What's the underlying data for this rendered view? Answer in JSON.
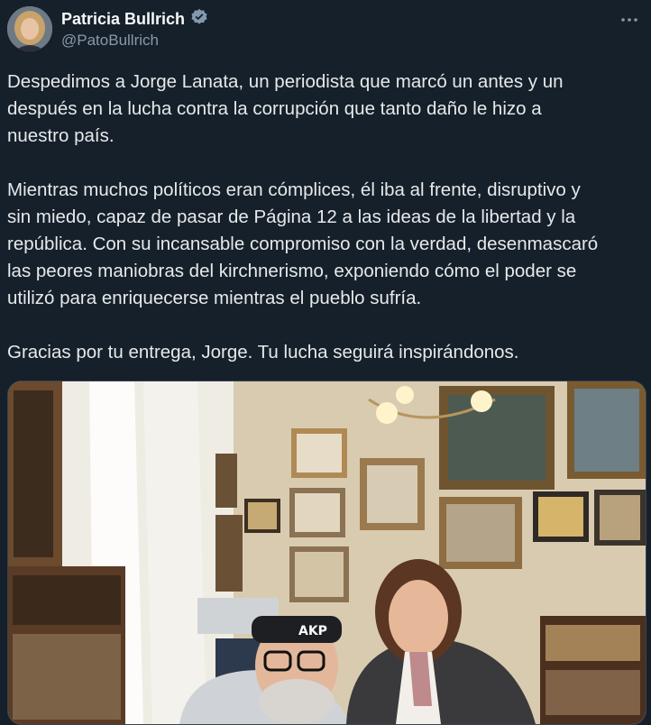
{
  "author": {
    "display_name": "Patricia Bullrich",
    "handle": "@PatoBullrich",
    "verified_icon": "verified-badge-icon",
    "avatar_icon": "avatar"
  },
  "tweet": {
    "text": "Despedimos a Jorge Lanata, un periodista que marcó un antes y un\ndespués en la lucha contra la corrupción que tanto daño le hizo a\nnuestro país.\n\nMientras muchos políticos eran cómplices, él iba al frente, disruptivo y\nsin miedo, capaz de pasar de Página 12 a las ideas de la libertad y la\nrepública. Con su incansable compromiso con la verdad, desenmascaró\nlas peores maniobras del kirchnerismo, exponiendo cómo el poder se\nutilizó para enriquecerse mientras el pueblo sufría.\n\nGracias por tu entrega, Jorge. Tu lucha seguirá inspirándonos."
  },
  "media": {
    "headband_text": "AKP"
  },
  "colors": {
    "background": "#15202b",
    "text": "#e7e9ea",
    "secondary": "#8b98a5",
    "verified": "#829aab"
  }
}
